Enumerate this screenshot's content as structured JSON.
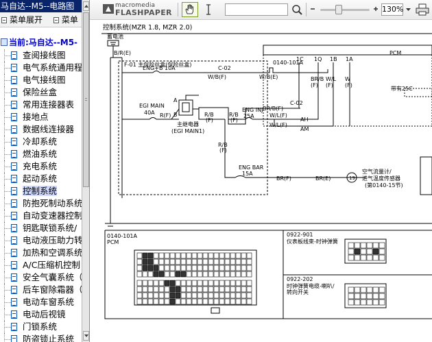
{
  "left_panel": {
    "title": "马自达--M5--电路图",
    "toolbar": {
      "expand_label": "菜单展开",
      "collapse_label": "菜单"
    },
    "root_label": "当前:马自达--M5-",
    "items": [
      "查阅接线图",
      "电气系统通用程",
      "电气接线图",
      "保险丝盒",
      "常用连接器表",
      "接地点",
      "数据线连接器",
      "冷却系统",
      "燃油系统",
      "充电系统",
      "起动系统",
      "控制系统",
      "防抱死制动系统",
      "自动变速器控制",
      "钥匙联锁系统/",
      "电动液压助力转",
      "加热和空调系统",
      "A/C压缩机控制",
      "安全气囊系统（",
      "后车窗除霜器（",
      "电动车窗系统",
      "电动后视镜",
      "门锁系统",
      "防盗锁止系统"
    ],
    "selected_index": 11
  },
  "viewer_toolbar": {
    "brand_line1": "macromedia",
    "brand_line2": "FLASHPAPER",
    "find_value": "",
    "zoom_value": "130%"
  },
  "diagram": {
    "title": "控制系统(MZR 1.8, MZR 2.0)",
    "battery_label": "蓄电池",
    "battery_wire": "B/R(E)",
    "fuse_box_label": "F-01 主保险丝盒(保险丝盒)",
    "eng_b_fuse": "ENG+B 10A",
    "egi_main_fuse": "EGI MAIN",
    "egi_main_amp": "40A",
    "main_relay": "主继电器",
    "main_relay_sub": "(EGI MAIN1)",
    "relay_a": "A",
    "relay_b": "B",
    "eng_inj_fuse": "ENG INJ",
    "eng_inj_amp": "25A",
    "eng_bar_fuse": "ENG BAR",
    "eng_bar_amp": "15A",
    "connector_c02": "C-02",
    "pcm_label": "PCM",
    "pcm_connector": "0140-101A",
    "pins_top": [
      "1C",
      "1Q",
      "1B",
      "1A"
    ],
    "pin_colors": [
      "BR/B",
      "W/L",
      "W"
    ],
    "pin_suffix": [
      "(F)",
      "(F)",
      "(F)"
    ],
    "pin_ah": "AH",
    "pin_am": "AM",
    "wires": {
      "w1": "W/B(F)",
      "w2": "W/B(E)",
      "w3": "R(F)",
      "w4": "R/B",
      "w4b": "(F)",
      "w5": "R/B",
      "w5b": "(F)",
      "w6": "BR/B(F)",
      "w7": "W/L(F)",
      "w8": "W/L(F)",
      "w9": "R/B",
      "w9b": "(F)",
      "w10": "BR(F)",
      "w11": "BR(E)",
      "w12": "R(F)"
    },
    "airflow_sensor": "空气流量计/",
    "airflow_sensor_2": "进气温度传感器",
    "airflow_sensor_3": "(第0140-15节)",
    "airflow_circle": "19",
    "right_block_label": "带有25C",
    "bottom_left_conn": "0140-101A",
    "bottom_left_sub": "PCM",
    "bottom_right_conn1": "0922-901",
    "bottom_right_sub1": "仪表板线束-时钟弹簧",
    "bottom_right_conn2": "0922-202",
    "bottom_right_sub2": "时钟弹簧电缆-喇叭/",
    "bottom_right_sub2b": "转向开关"
  }
}
